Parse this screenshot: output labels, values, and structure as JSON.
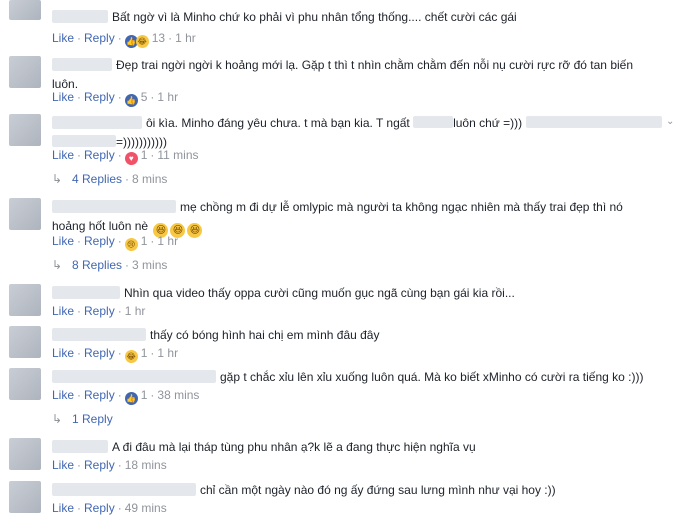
{
  "actions": {
    "like": "Like",
    "reply": "Reply",
    "sep": "·"
  },
  "comments": [
    {
      "text": "Bất ngờ vì là Minho chứ ko phải vì phu nhân tổng thống.... chết cười các gái",
      "reacts": "13",
      "time": "1 hr"
    },
    {
      "text_line1": "Đẹp trai ngời ngời k hoảng mới lạ. Gặp t thì t nhìn chằm chằm đến nỗi nụ cười rực rỡ đó tan biến",
      "text_line2": "luôn.",
      "reacts": "5",
      "time": "1 hr"
    },
    {
      "text_part1": "ôi kìa. Minho đáng yêu chưa. t mà bạn kia. T ngất",
      "text_part2": "luôn chứ =)))",
      "text_line2": "=)))))))))))",
      "reacts": "1",
      "time": "11 mins"
    },
    {
      "text_line1": "mẹ chồng m đi dự lễ omlypic mà người ta không ngạc nhiên mà thấy trai đẹp thì nó",
      "text_line2": "hoảng hốt luôn nè",
      "reacts": "1",
      "time": "1 hr"
    },
    {
      "text": "Nhìn qua video thấy oppa cười cũng muốn gục ngã cùng bạn gái kia rồi...",
      "time": "1 hr"
    },
    {
      "text": "thấy có bóng hình hai chị em mình đâu đây",
      "reacts": "1",
      "time": "1 hr"
    },
    {
      "text": "gặp t chắc xỉu lên xỉu xuống luôn quá. Mà ko biết xMinho có cười ra tiếng ko :)))",
      "reacts": "1",
      "time": "38 mins"
    },
    {
      "text": "A đi đâu mà lại tháp tùng phu nhân ạ?k lẽ a đang thực hiện nghĩa vụ",
      "time": "18 mins"
    },
    {
      "text": "chỉ cần một ngày nào đó ng ấy đứng sau lưng mình như vại hoy :))",
      "time": "49 mins"
    }
  ],
  "replies": [
    {
      "label": "4 Replies",
      "time": "8 mins"
    },
    {
      "label": "8 Replies",
      "time": "3 mins"
    },
    {
      "label": "1 Reply"
    }
  ],
  "icons": {
    "like": "like-reaction-icon",
    "love": "love-reaction-icon",
    "haha": "haha-reaction-icon",
    "sad": "sad-reaction-icon",
    "smile": "smile-emoji-icon",
    "reply": "reply-arrow-icon"
  }
}
